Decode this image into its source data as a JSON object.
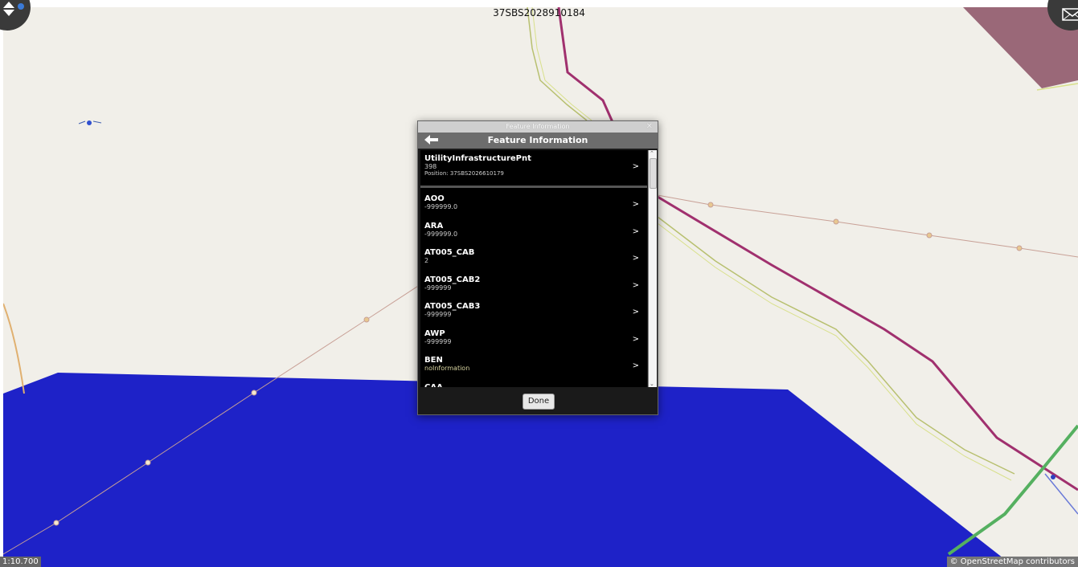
{
  "map": {
    "title": "37SBS2028910184",
    "scale": "1:10.700",
    "attribution": "© OpenStreetMap contributors"
  },
  "icons": {
    "zoom_toggle": "up-down-arrows-icon",
    "messages": "envelope-icon",
    "back": "back-arrow-icon"
  },
  "dialog": {
    "window_title": "Feature Information",
    "header": "Feature Information",
    "close": "✕",
    "feature": {
      "name": "UtilityInfrastructurePnt",
      "id": "398",
      "position": "Position: 37SBS2026610179"
    },
    "attributes": [
      {
        "name": "AOO",
        "value": "-999999.0"
      },
      {
        "name": "ARA",
        "value": "-999999.0"
      },
      {
        "name": "AT005_CAB",
        "value": "2"
      },
      {
        "name": "AT005_CAB2",
        "value": "-999999"
      },
      {
        "name": "AT005_CAB3",
        "value": "-999999"
      },
      {
        "name": "AWP",
        "value": "-999999"
      },
      {
        "name": "BEN",
        "value": "noInformation"
      },
      {
        "name": "CAA",
        "value": ""
      }
    ],
    "chevron": ">",
    "done_label": "Done"
  },
  "colors": {
    "water": "#1e22c8",
    "road_primary": "#a0306e",
    "road_secondary": "#d8e08a",
    "restricted_area": "#9a6878",
    "power_line": "#c8a096"
  }
}
